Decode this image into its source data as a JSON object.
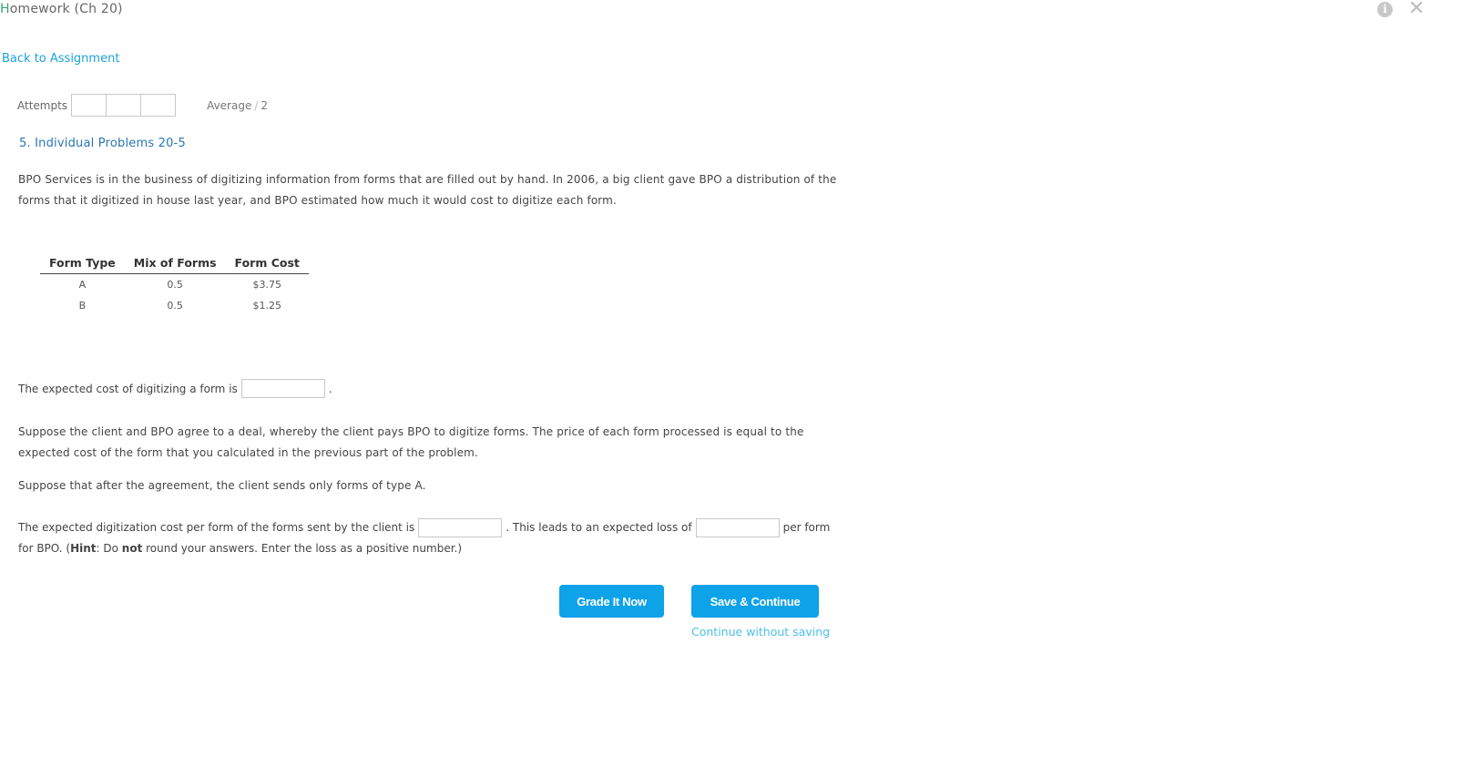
{
  "header": {
    "title_first_letter": "H",
    "title_rest": "omework (Ch 20)",
    "info_icon_glyph": "i",
    "close_icon_glyph": "✕"
  },
  "nav": {
    "back_link": "Back to Assignment"
  },
  "attempts": {
    "label": "Attempts",
    "average_label": "Average",
    "average_separator": "/",
    "average_value": "2"
  },
  "problem": {
    "title": "5. Individual Problems 20-5",
    "intro": "BPO Services is in the business of digitizing information from forms that are filled out by hand. In 2006, a big client gave BPO a distribution of the forms that it digitized in house last year, and BPO estimated how much it would cost to digitize each form.",
    "table": {
      "headers": [
        "Form Type",
        "Mix of Forms",
        "Form Cost"
      ],
      "rows": [
        [
          "A",
          "0.5",
          "$3.75"
        ],
        [
          "B",
          "0.5",
          "$1.25"
        ]
      ]
    },
    "q1_text": "The expected cost of digitizing a form is",
    "q1_suffix": ".",
    "deal_text": "Suppose the client and BPO agree to a deal, whereby the client pays BPO to digitize forms. The price of each form processed is equal to the expected cost of the form that you calculated in the previous part of the problem.",
    "suppose_text": "Suppose that after the agreement, the client sends only forms of type A.",
    "q2_part1": "The expected digitization cost per form of the forms sent by the client is",
    "q2_part2": ". This leads to an expected loss of",
    "q2_part3": "per form for BPO. (",
    "q2_hint_label": "Hint",
    "q2_part4": ": Do",
    "q2_not": "not",
    "q2_part5": "round your answers. Enter the loss as a positive number.)"
  },
  "actions": {
    "grade_button": "Grade It Now",
    "save_button": "Save & Continue",
    "continue_link": "Continue without saving"
  },
  "colors": {
    "link": "#1ba1dc",
    "title_blue": "#2a77b5",
    "button_bg": "#0ea2e8"
  }
}
